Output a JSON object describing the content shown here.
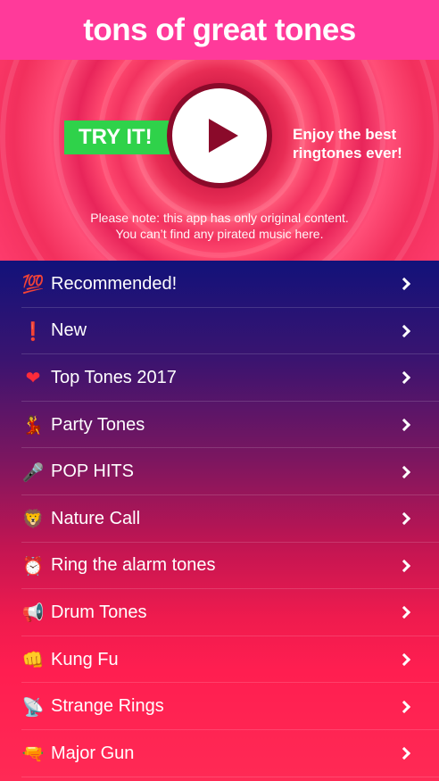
{
  "header": {
    "title": "tons of great tones"
  },
  "hero": {
    "try_label": "TRY IT!",
    "tagline_line1": "Enjoy the best",
    "tagline_line2": "ringtones ever!",
    "note_line1": "Please note: this app has only original content.",
    "note_line2": "You can’t find any pirated music here."
  },
  "list": {
    "items": [
      {
        "label": "Recommended!",
        "icon": "hundred-points-icon",
        "glyph": "💯",
        "color": "#ff3b30"
      },
      {
        "label": "New",
        "icon": "exclamation-icon",
        "glyph": "❗",
        "color": "#ff2d2d"
      },
      {
        "label": "Top Tones 2017",
        "icon": "heart-icon",
        "glyph": "❤",
        "color": "#ff2b3a"
      },
      {
        "label": "Party Tones",
        "icon": "dancer-icon",
        "glyph": "💃",
        "color": "#e0264a"
      },
      {
        "label": "POP HITS",
        "icon": "microphone-icon",
        "glyph": "🎤",
        "color": "#666666"
      },
      {
        "label": "Nature Call",
        "icon": "lion-icon",
        "glyph": "🦁",
        "color": "#f2a33a"
      },
      {
        "label": "Ring the alarm tones",
        "icon": "alarm-clock-icon",
        "glyph": "⏰",
        "color": "#ff4b3a"
      },
      {
        "label": "Drum Tones",
        "icon": "megaphone-icon",
        "glyph": "📢",
        "color": "#c9c9c9"
      },
      {
        "label": "Kung Fu",
        "icon": "fist-icon",
        "glyph": "👊",
        "color": "#f5b53a"
      },
      {
        "label": "Strange Rings",
        "icon": "satellite-dish-icon",
        "glyph": "📡",
        "color": "#d9d9d9"
      },
      {
        "label": "Major Gun",
        "icon": "water-pistol-icon",
        "glyph": "🔫",
        "color": "#34c759"
      }
    ]
  }
}
